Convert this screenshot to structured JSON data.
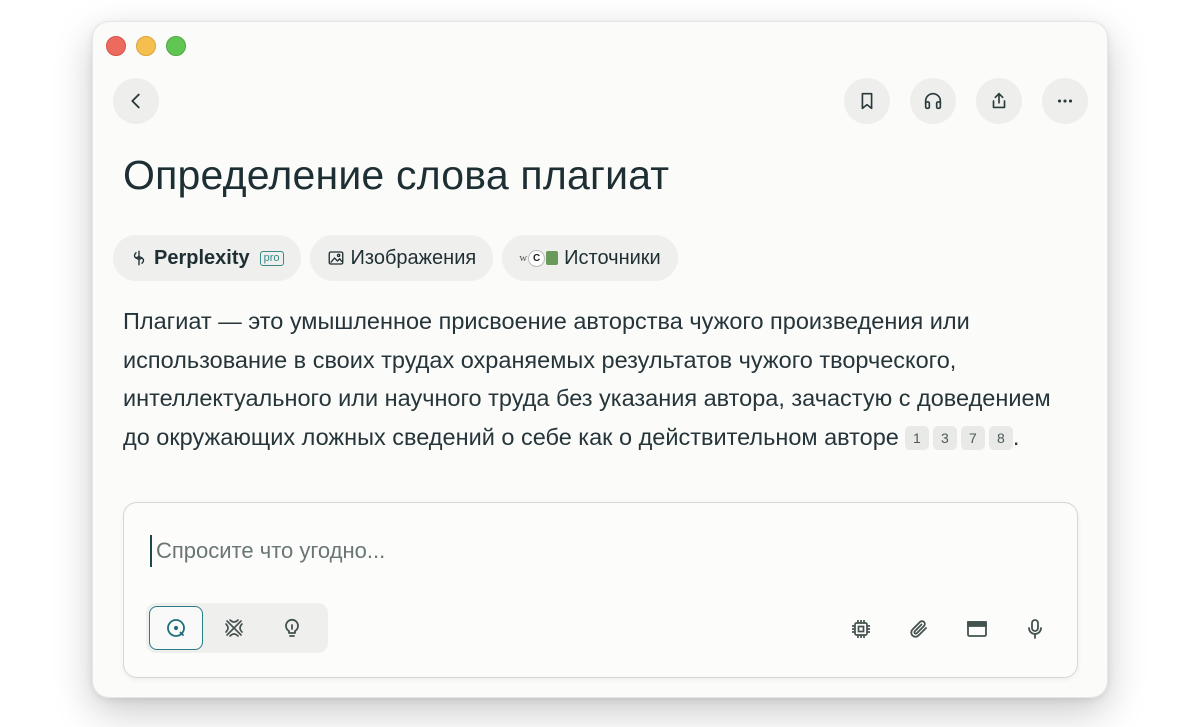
{
  "window": {
    "traffic_lights": [
      "close",
      "minimize",
      "zoom"
    ]
  },
  "toolbar": {
    "back_icon": "chevron-left-icon",
    "bookmark_icon": "bookmark-icon",
    "listen_icon": "headphones-icon",
    "share_icon": "share-icon",
    "more_icon": "more-horizontal-icon"
  },
  "page": {
    "title": "Определение слова плагиат"
  },
  "tabs": [
    {
      "label": "Perplexity",
      "badge": "pro",
      "icon": "perplexity-logo-icon",
      "active": true
    },
    {
      "label": "Изображения",
      "icon": "image-icon",
      "active": false
    },
    {
      "label": "Источники",
      "icon": "source-favicons-icon",
      "active": false
    }
  ],
  "answer": {
    "text": "Плагиат — это умышленное присвоение авторства чужого произведения или использование в своих трудах охраняемых результатов чужого творческого, интеллектуального или научного труда без указания автора, зачастую с доведением до окружающих ложных сведений о себе как о действительном авторе",
    "citations": [
      "1",
      "3",
      "7",
      "8"
    ],
    "end_punct": "."
  },
  "composer": {
    "placeholder": "Спросите что угодно...",
    "value": "",
    "modes": [
      {
        "name": "search",
        "icon": "search-icon",
        "active": true
      },
      {
        "name": "research",
        "icon": "research-icon",
        "active": false
      },
      {
        "name": "labs",
        "icon": "lightbulb-icon",
        "active": false
      }
    ],
    "tools": [
      "model-chip-icon",
      "paperclip-icon",
      "browser-window-icon",
      "microphone-icon"
    ]
  },
  "colors": {
    "accent": "#2a7c86",
    "text": "#1e2f33",
    "window_bg": "#fbfbfa"
  }
}
